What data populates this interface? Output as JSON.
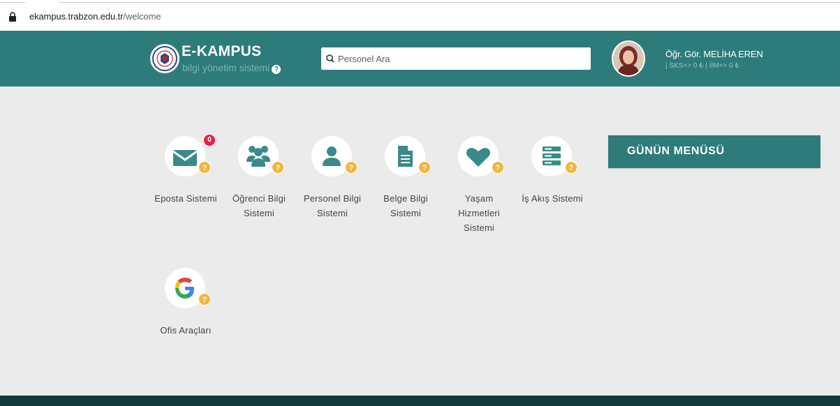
{
  "browser": {
    "url_host": "ekampus.trabzon.edu.tr",
    "url_path": "/welcome"
  },
  "header": {
    "title": "E-KAMPUS",
    "subtitle": "bilgi yönetim sistemi",
    "help_glyph": "?",
    "search_placeholder": "Personel Ara",
    "user_name": "Öğr. Gör. MELİHA EREN",
    "user_sub": "| SKS=> 0 ₺ | İİM=> 0 ₺"
  },
  "apps": [
    {
      "label": "Eposta Sistemi",
      "icon": "envelope-icon",
      "count": "0"
    },
    {
      "label": "Öğrenci Bilgi Sistemi",
      "icon": "users-icon"
    },
    {
      "label": "Personel Bilgi Sistemi",
      "icon": "user-icon"
    },
    {
      "label": "Belge Bilgi Sistemi",
      "icon": "document-icon"
    },
    {
      "label": "Yaşam Hizmetleri Sistemi",
      "icon": "heart-icon"
    },
    {
      "label": "İş Akış Sistemi",
      "icon": "server-icon"
    },
    {
      "label": "Ofis Araçları",
      "icon": "google-icon"
    }
  ],
  "help_badge": "?",
  "menu_panel": {
    "title": "GÜNÜN MENÜSÜ"
  },
  "colors": {
    "header": "#2e7b7b",
    "icon_teal": "#3a8a8a",
    "help_badge": "#f0b640",
    "count_badge": "#e4214d",
    "background": "#ebebeb",
    "footer": "#133a3b"
  }
}
